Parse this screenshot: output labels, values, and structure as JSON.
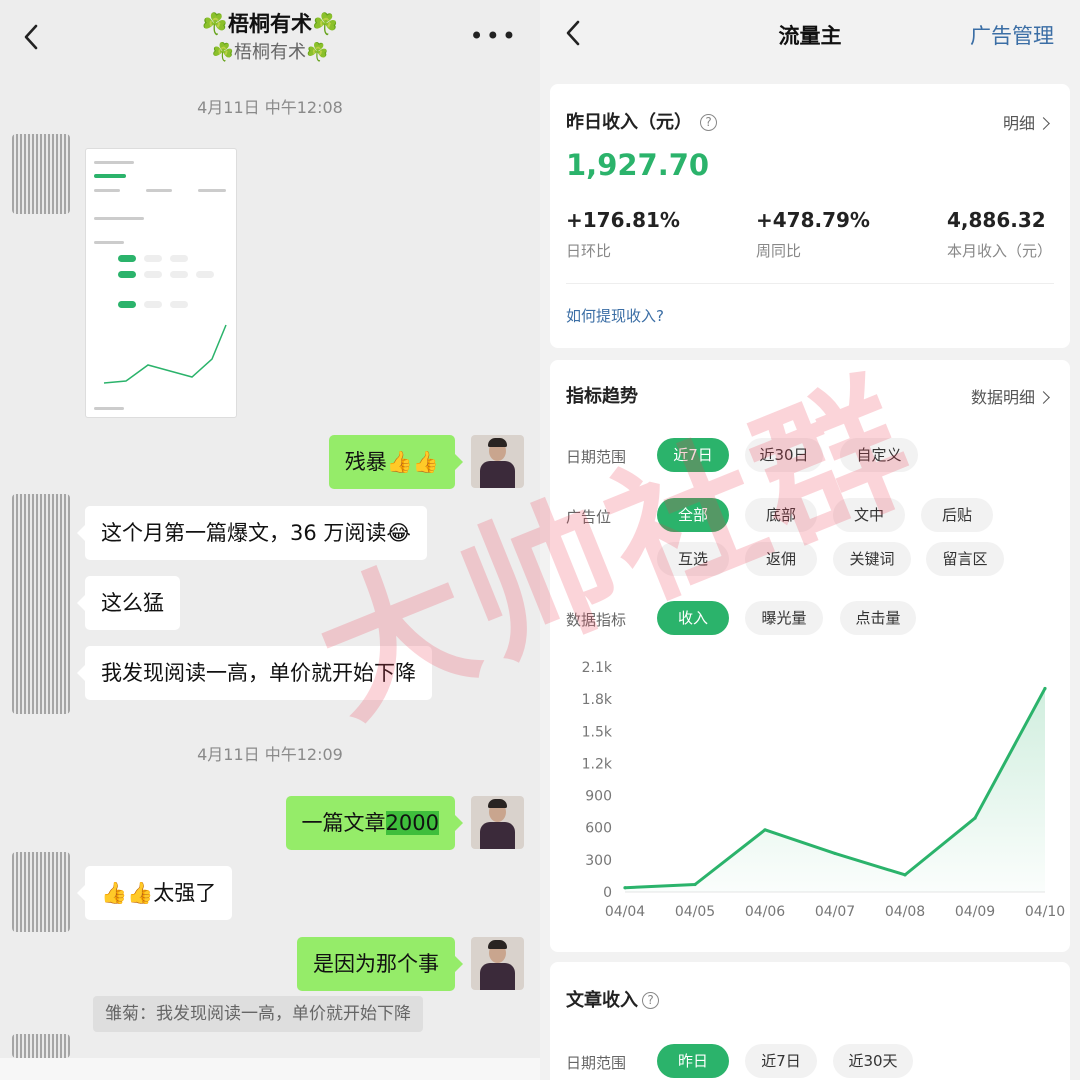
{
  "chat": {
    "title": "☘️梧桐有术☘️",
    "subtitle": "☘️梧桐有术☘️",
    "timestamps": [
      "4月11日 中午12:08",
      "4月11日 中午12:09"
    ],
    "messages": {
      "m1": "残暴👍👍",
      "m2": "这个月第一篇爆文，36 万阅读😂",
      "m3": "这么猛",
      "m4": "我发现阅读一高，单价就开始下降",
      "m5_a": "一篇文章",
      "m5_b": "2000",
      "m6": "👍👍太强了",
      "m7": "是因为那个事"
    },
    "quote": "雏菊：我发现阅读一高，单价就开始下降"
  },
  "dash": {
    "title": "流量主",
    "manage": "广告管理",
    "yesterday": {
      "title": "昨日收入（元）",
      "detail": "明细",
      "value": "1,927.70",
      "stats": [
        {
          "value": "+176.81%",
          "label": "日环比"
        },
        {
          "value": "+478.79%",
          "label": "周同比"
        },
        {
          "value": "4,886.32",
          "label": "本月收入（元）"
        }
      ],
      "howto": "如何提现收入?"
    },
    "trend": {
      "title": "指标趋势",
      "detail": "数据明细",
      "date_label": "日期范围",
      "date_chips": [
        "近7日",
        "近30日",
        "自定义"
      ],
      "ad_label": "广告位",
      "ad_chips_row1": [
        "全部",
        "底部",
        "文中",
        "后贴"
      ],
      "ad_chips_row2": [
        "互选",
        "返佣",
        "关键词",
        "留言区"
      ],
      "metric_label": "数据指标",
      "metric_chips": [
        "收入",
        "曝光量",
        "点击量"
      ]
    },
    "article": {
      "title": "文章收入",
      "date_label": "日期范围",
      "date_chips": [
        "昨日",
        "近7日",
        "近30天"
      ]
    },
    "colors": {
      "accent": "#2bb36b",
      "link": "#3b6ea5"
    }
  },
  "chart_data": {
    "type": "line",
    "categories": [
      "04/04",
      "04/05",
      "04/06",
      "04/07",
      "04/08",
      "04/09",
      "04/10"
    ],
    "values": [
      40,
      70,
      580,
      360,
      160,
      690,
      1900
    ],
    "yticks": [
      "0",
      "300",
      "600",
      "900",
      "1.2k",
      "1.5k",
      "1.8k",
      "2.1k"
    ],
    "ylim": [
      0,
      2100
    ],
    "grid": false,
    "color": "#2bb36b"
  },
  "watermark": "大帅社群"
}
